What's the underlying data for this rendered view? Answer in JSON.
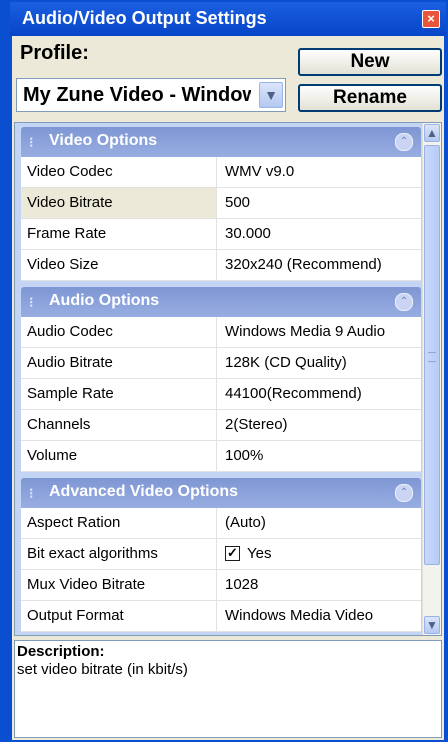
{
  "window": {
    "title": "Audio/Video Output Settings"
  },
  "profile": {
    "label": "Profile:",
    "selected": "My Zune Video - Windows",
    "new_label": "New",
    "rename_label": "Rename"
  },
  "sections": {
    "video": {
      "title": "Video Options",
      "rows": [
        {
          "key": "Video Codec",
          "value": "WMV v9.0"
        },
        {
          "key": "Video Bitrate",
          "value": "500"
        },
        {
          "key": "Frame Rate",
          "value": "30.000"
        },
        {
          "key": "Video Size",
          "value": "320x240 (Recommend)"
        }
      ]
    },
    "audio": {
      "title": "Audio Options",
      "rows": [
        {
          "key": "Audio Codec",
          "value": "Windows Media 9 Audio"
        },
        {
          "key": "Audio Bitrate",
          "value": "128K (CD Quality)"
        },
        {
          "key": "Sample Rate",
          "value": "44100(Recommend)"
        },
        {
          "key": "Channels",
          "value": "2(Stereo)"
        },
        {
          "key": "Volume",
          "value": "100%"
        }
      ]
    },
    "advanced": {
      "title": "Advanced Video Options",
      "rows": [
        {
          "key": "Aspect Ration",
          "value": "(Auto)"
        },
        {
          "key": "Bit exact algorithms",
          "value": "Yes",
          "checked": true
        },
        {
          "key": "Mux Video Bitrate",
          "value": "1028"
        },
        {
          "key": "Output Format",
          "value": "Windows Media Video"
        }
      ]
    }
  },
  "description": {
    "title": "Description:",
    "text": "set video bitrate (in kbit/s)"
  },
  "icons": {
    "close": "close-icon",
    "dropdown": "chevron-down-icon",
    "collapse": "collapse-up-icon",
    "scroll_up": "scroll-up-icon",
    "scroll_down": "scroll-down-icon",
    "grip": "grip-icon"
  }
}
